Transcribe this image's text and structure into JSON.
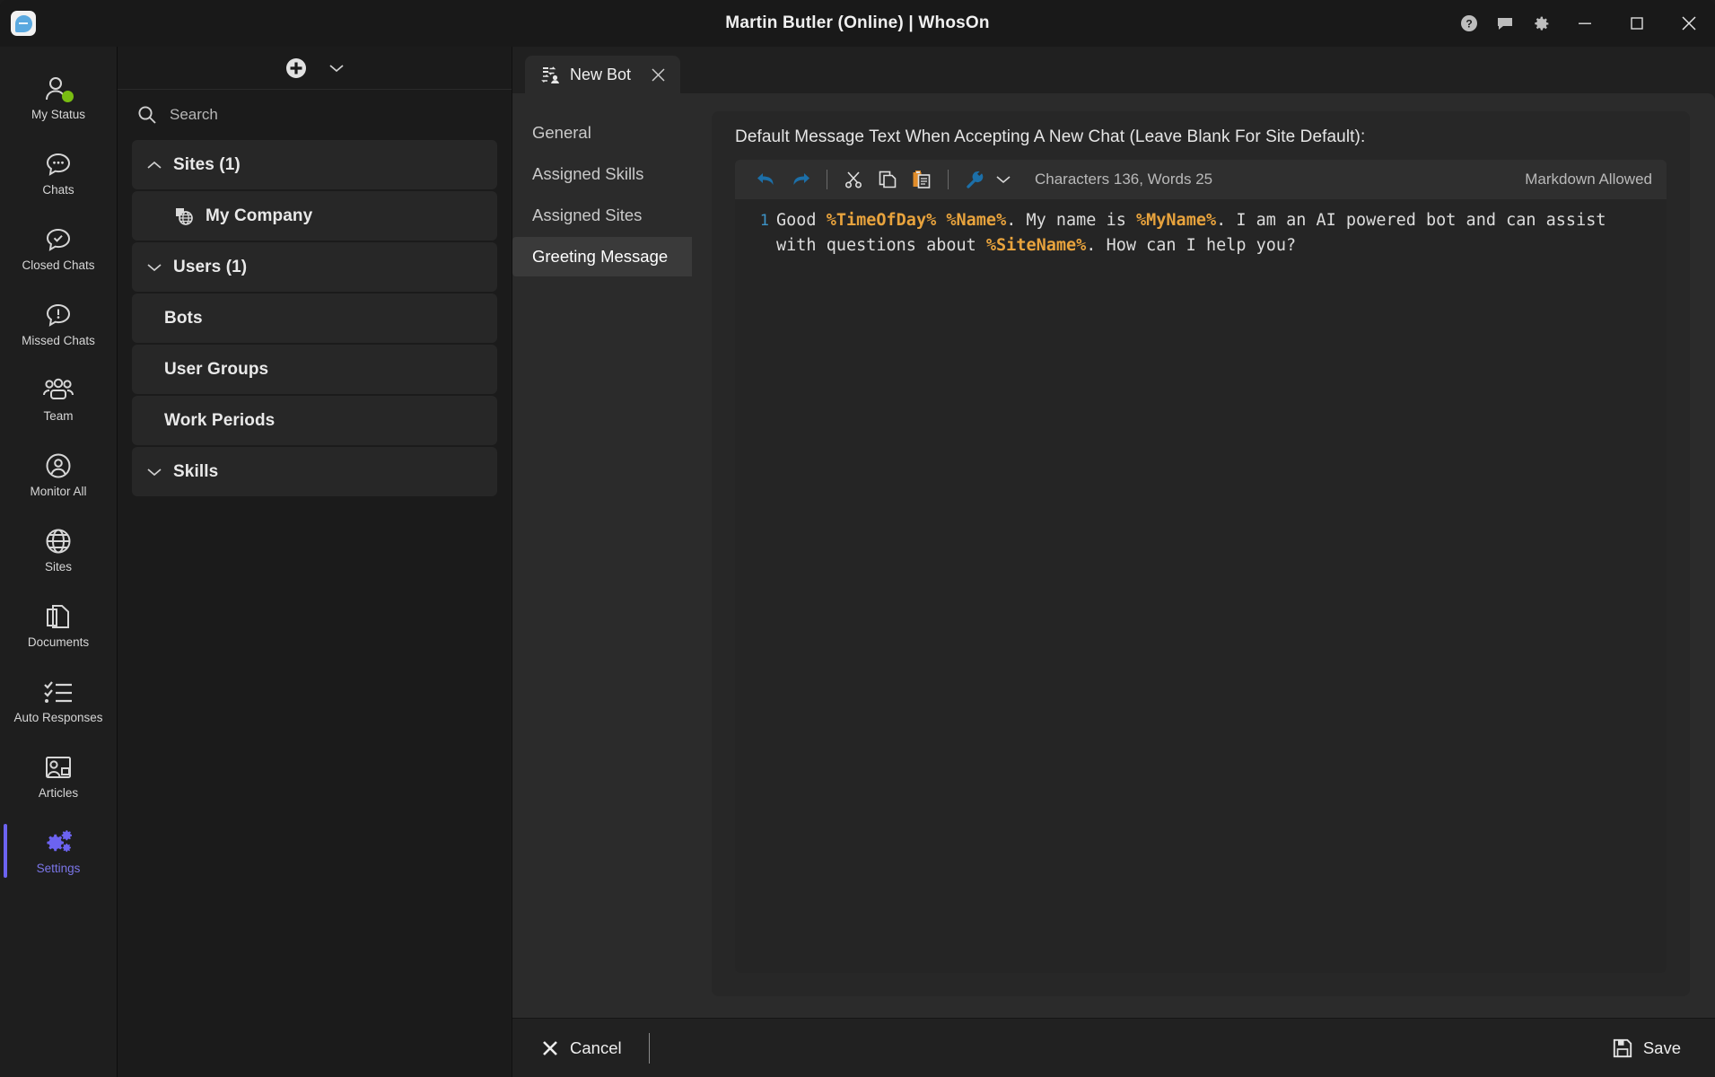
{
  "window": {
    "title": "Martin Butler (Online)  |  WhosOn",
    "app_icon": "chat-bubble-app-icon",
    "controls": {
      "help": "help-icon",
      "feedback": "feedback-icon",
      "settings": "gear-icon",
      "minimize": "minimize-icon",
      "maximize": "maximize-icon",
      "close": "close-icon"
    }
  },
  "rail": {
    "items": [
      {
        "label": "My Status",
        "icon": "person-status-icon",
        "active": false,
        "badge": "online"
      },
      {
        "label": "Chats",
        "icon": "chat-bubble-icon",
        "active": false
      },
      {
        "label": "Closed Chats",
        "icon": "chat-check-icon",
        "active": false
      },
      {
        "label": "Missed Chats",
        "icon": "chat-alert-icon",
        "active": false
      },
      {
        "label": "Team",
        "icon": "people-group-icon",
        "active": false
      },
      {
        "label": "Monitor All",
        "icon": "person-circle-icon",
        "active": false
      },
      {
        "label": "Sites",
        "icon": "globe-icon",
        "active": false
      },
      {
        "label": "Documents",
        "icon": "documents-icon",
        "active": false
      },
      {
        "label": "Auto Responses",
        "icon": "checklist-icon",
        "active": false
      },
      {
        "label": "Articles",
        "icon": "article-person-icon",
        "active": false
      },
      {
        "label": "Settings",
        "icon": "gears-icon",
        "active": true
      }
    ],
    "accent_color": "#6c63f0",
    "status_color": "#79bd12"
  },
  "tree_panel": {
    "add_button": "add-plus-icon",
    "dropdown_button": "chevron-down-icon",
    "search": {
      "placeholder": "Search",
      "value": "",
      "icon": "search-icon"
    },
    "nodes": [
      {
        "label": "Sites (1)",
        "level": 0,
        "expander": "chevron-up",
        "icon": null
      },
      {
        "label": "My Company",
        "level": 1,
        "expander": null,
        "icon": "site-globe-icon"
      },
      {
        "label": "Users (1)",
        "level": 0,
        "expander": "chevron-down",
        "icon": null
      },
      {
        "label": "Bots",
        "level": 1,
        "expander": null,
        "icon": null
      },
      {
        "label": "User Groups",
        "level": 1,
        "expander": null,
        "icon": null
      },
      {
        "label": "Work Periods",
        "level": 1,
        "expander": null,
        "icon": null
      },
      {
        "label": "Skills",
        "level": 0,
        "expander": "chevron-down",
        "icon": null
      }
    ]
  },
  "tabs": [
    {
      "label": "New Bot",
      "icon": "bot-transfer-icon",
      "close": "close-icon",
      "active": true
    }
  ],
  "subnav": {
    "items": [
      {
        "label": "General",
        "active": false
      },
      {
        "label": "Assigned Skills",
        "active": false
      },
      {
        "label": "Assigned Sites",
        "active": false
      },
      {
        "label": "Greeting Message",
        "active": true
      }
    ]
  },
  "editor": {
    "field_label": "Default Message Text When Accepting A New Chat (Leave Blank For Site Default):",
    "toolbar": {
      "undo": "undo-arrow-icon",
      "redo": "redo-arrow-icon",
      "cut": "scissors-icon",
      "copy": "copy-icon",
      "paste": "paste-icon",
      "tools": "wrench-icon",
      "more": "chevron-down-icon",
      "counts": "Characters 136, Words 25",
      "markdown_note": "Markdown Allowed"
    },
    "line_number": "1",
    "content_plain": "Good %TimeOfDay% %Name%. My name is %MyName%. I am an AI powered bot and can assist with questions about %SiteName%. How can I help you?",
    "content_tokens": [
      {
        "t": "Good ",
        "type": "text"
      },
      {
        "t": "%TimeOfDay%",
        "type": "token"
      },
      {
        "t": " ",
        "type": "text"
      },
      {
        "t": "%Name%",
        "type": "token"
      },
      {
        "t": ". My name is ",
        "type": "text"
      },
      {
        "t": "%MyName%",
        "type": "token"
      },
      {
        "t": ". I am an AI powered bot and can assist with questions about ",
        "type": "text"
      },
      {
        "t": "%SiteName%",
        "type": "token"
      },
      {
        "t": ". How can I help you?",
        "type": "text"
      }
    ],
    "token_color": "#e8a33d",
    "gutter_color": "#3d94c8"
  },
  "footer": {
    "cancel_label": "Cancel",
    "cancel_icon": "close-x-icon",
    "save_label": "Save",
    "save_icon": "floppy-save-icon"
  }
}
